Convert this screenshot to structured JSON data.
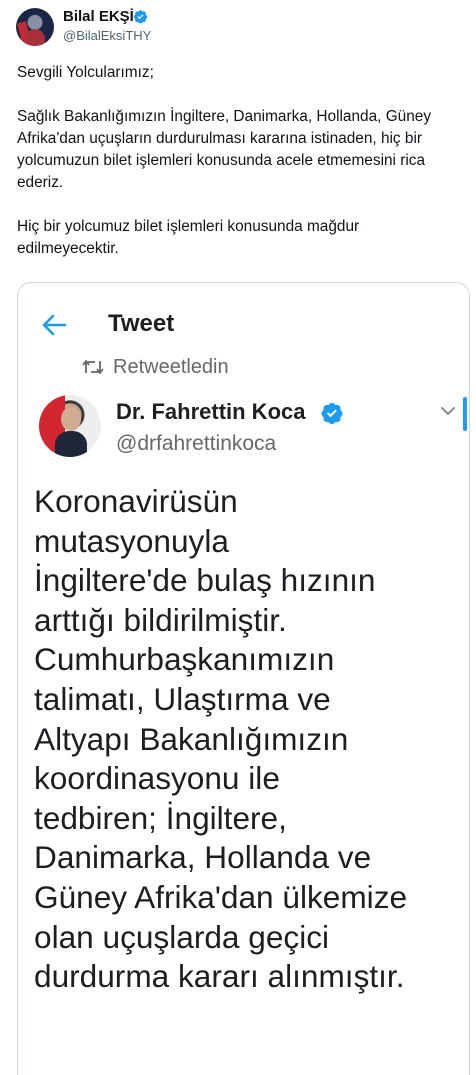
{
  "author": {
    "name": "Bilal EKŞİ",
    "handle": "@BilalEksiTHY",
    "verified_color": "#1d9bf0"
  },
  "tweet": {
    "paragraph1": "Sevgili Yolcularımız;",
    "paragraph2": "Sağlık Bakanlığımızın İngiltere, Danimarka, Hollanda, Güney Afrika'dan uçuşların durdurulması kararına istinaden,  hiç bir yolcumuzun bilet işlemleri konusunda acele etmemesini rica ederiz.",
    "paragraph3": "Hiç bir yolcumuz bilet işlemleri konusunda mağdur edilmeyecektir."
  },
  "embedded_screenshot": {
    "title": "Tweet",
    "back_icon": "back-arrow-icon",
    "retweet_label": "Retweetledin",
    "author_name": "Dr. Fahrettin Koca",
    "author_handle": "@drfahrettinkoca",
    "body": "Koronavirüsün\nmutasyonuyla\nİngiltere'de bulaş hızının\narttığı bildirilmiştir.\nCumhurbaşkanımızın\ntalimatı, Ulaştırma ve\nAltyapı Bakanlığımızın\nkoordinasyonu ile\ntedbiren; İngiltere,\nDanimarka, Hollanda ve\nGüney Afrika'dan ülkemize\nolan uçuşlarda geçici\ndurdurma kararı alınmıştır."
  },
  "colors": {
    "accent": "#1d9bf0",
    "text": "#0f1419",
    "secondary_text": "#536471"
  }
}
